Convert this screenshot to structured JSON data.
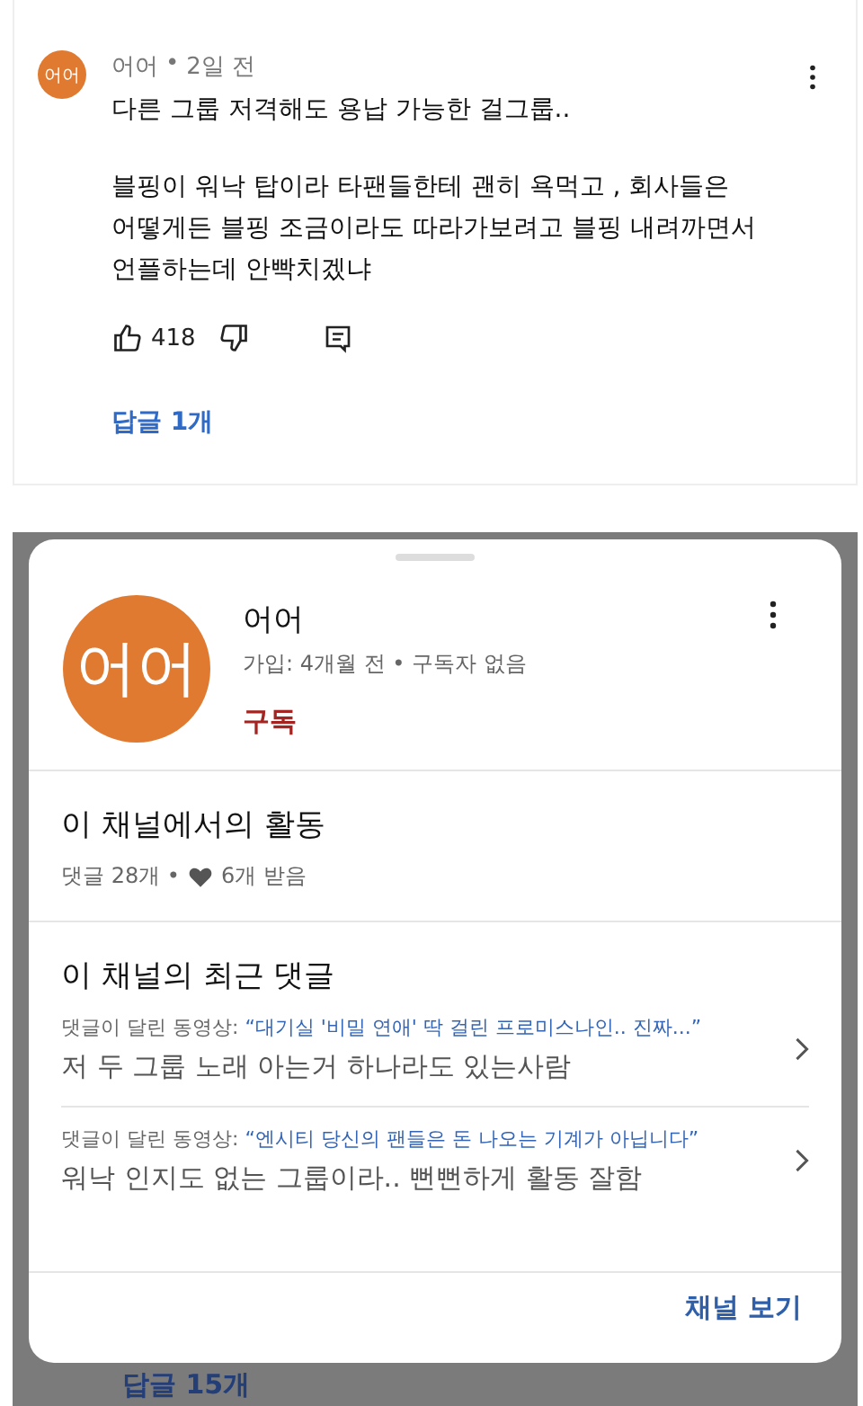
{
  "comment": {
    "avatar_text": "어어",
    "author": "어어",
    "separator": "•",
    "time": "2일 전",
    "paragraphs": [
      "다른 그룹 저격해도 용납 가능한 걸그룹..",
      "블핑이 워낙 탑이라 타팬들한테 괜히 욕먹고 , 회사들은 어떻게든 블핑 조금이라도 따라가보려고 블핑 내려까면서 언플하는데 안빡치겠냐"
    ],
    "likes": "418",
    "replies": "답글 1개"
  },
  "sheet": {
    "avatar_text": "어어",
    "name": "어어",
    "meta": "가입: 4개월 전 • 구독자 없음",
    "subscribe": "구독",
    "activity": {
      "title": "이 채널에서의 활동",
      "comments": "댓글 28개 •",
      "hearts": "6개 받음"
    },
    "recent": {
      "title": "이 채널의 최근 댓글",
      "items": [
        {
          "label": "댓글이 달린 동영상:",
          "video": "“대기실 '비밀 연애' 딱 걸린 프로미스나인.. 진짜...”",
          "text": "저 두 그룹 노래 아는거 하나라도 있는사람"
        },
        {
          "label": "댓글이 달린 동영상:",
          "video": "“엔시티 당신의 팬들은 돈 나오는 기계가 아닙니다”",
          "text": "워낙 인지도 없는 그룹이라.. 뻔뻔하게 활동 잘함"
        }
      ]
    },
    "view_channel": "채널 보기"
  },
  "background_replies": "답글 15개"
}
